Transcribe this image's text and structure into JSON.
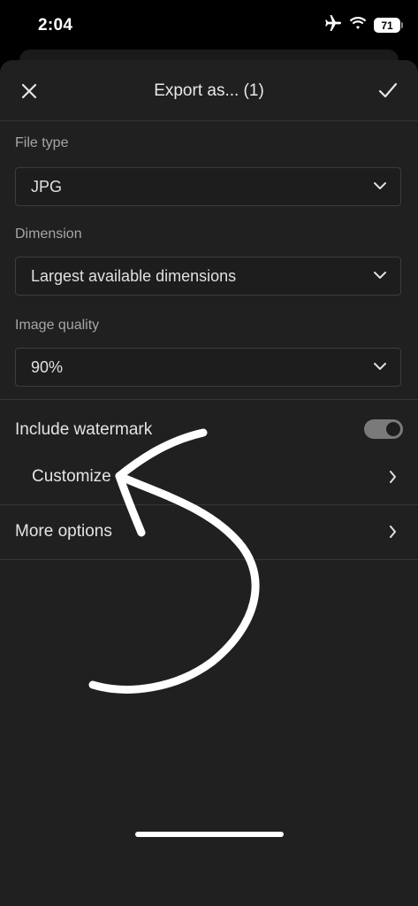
{
  "status_bar": {
    "time": "2:04",
    "battery": "71",
    "icons": [
      "airplane-icon",
      "wifi-icon",
      "battery-icon"
    ]
  },
  "header": {
    "title": "Export as... (1)",
    "close_icon": "close-icon",
    "confirm_icon": "checkmark-icon"
  },
  "fields": {
    "file_type": {
      "label": "File type",
      "value": "JPG"
    },
    "dimension": {
      "label": "Dimension",
      "value": "Largest available dimensions"
    },
    "image_quality": {
      "label": "Image quality",
      "value": "90%"
    }
  },
  "watermark": {
    "label": "Include watermark",
    "enabled": true,
    "customize_label": "Customize"
  },
  "more_options": {
    "label": "More options"
  },
  "colors": {
    "background": "#000000",
    "sheet": "#202020",
    "text": "#e4e4e4",
    "label": "#a6a6a6",
    "toggle_on": "#7a7a7a",
    "annotation": "#ffffff"
  }
}
